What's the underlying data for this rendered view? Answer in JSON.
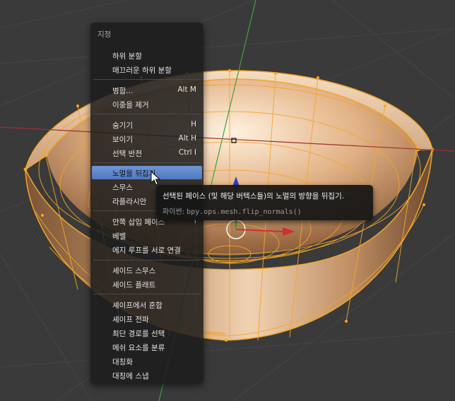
{
  "menu": {
    "title": "지정",
    "items": [
      {
        "label": "하위 분할",
        "shortcut": ""
      },
      {
        "label": "매끄러운 하위 분할",
        "shortcut": ""
      },
      {
        "label": "병합...",
        "shortcut": "Alt M"
      },
      {
        "label": "이중을 제거",
        "shortcut": ""
      },
      {
        "label": "숨기기",
        "shortcut": "H"
      },
      {
        "label": "보이기",
        "shortcut": "Alt H"
      },
      {
        "label": "선택 반전",
        "shortcut": "Ctrl I"
      },
      {
        "label": "노멀을 뒤집기",
        "shortcut": ""
      },
      {
        "label": "스무스",
        "shortcut": ""
      },
      {
        "label": "라플라시안",
        "shortcut": ""
      },
      {
        "label": "안쪽 삽입 페이스",
        "shortcut": "I"
      },
      {
        "label": "베벨",
        "shortcut": ""
      },
      {
        "label": "에지 루프를 서로 연결",
        "shortcut": ""
      },
      {
        "label": "셰이드 스무스",
        "shortcut": ""
      },
      {
        "label": "셰이드 플래트",
        "shortcut": ""
      },
      {
        "label": "셰이프에서 혼합",
        "shortcut": ""
      },
      {
        "label": "셰이프 전파",
        "shortcut": ""
      },
      {
        "label": "최단 경로를 선택",
        "shortcut": ""
      },
      {
        "label": "메쉬 요소를 분류",
        "shortcut": ""
      },
      {
        "label": "대칭화",
        "shortcut": ""
      },
      {
        "label": "대칭에 스냅",
        "shortcut": ""
      }
    ]
  },
  "tooltip": {
    "description": "선택된 페이스 (및 해당 버텍스들)의 노멀의 방향을 뒤집기.",
    "python_label": "파이썬:",
    "python_code": "bpy.ops.mesh.flip_normals()"
  },
  "colors": {
    "background": "#3a3a3a",
    "menu_highlight": "#5f86cc",
    "mesh_wire": "#f5a52a",
    "axis_x": "#d03030",
    "axis_y": "#3ea03e"
  },
  "icons": [
    "mouse-cursor-icon",
    "transform-arrow-icon"
  ]
}
